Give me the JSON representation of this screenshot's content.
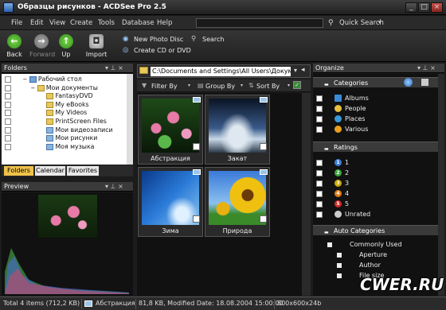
{
  "window": {
    "title": "Образцы рисунков - ACDSee Pro 2.5"
  },
  "menu": [
    "File",
    "Edit",
    "View",
    "Create",
    "Tools",
    "Database",
    "Help"
  ],
  "quick_search": {
    "label": "Quick Search"
  },
  "toolbar": {
    "back": "Back",
    "forward": "Forward",
    "up": "Up",
    "import": "Import",
    "new_photo_disc": "New Photo Disc",
    "search": "Search",
    "create_cd": "Create CD or DVD"
  },
  "folders": {
    "title": "Folders",
    "items": [
      "Рабочий стол",
      "Мои документы",
      "FantasyDVD",
      "My eBooks",
      "My Videos",
      "PrintScreen Files",
      "Мои видеозаписи",
      "Мои рисунки",
      "Моя музыка"
    ],
    "tabs": [
      "Folders",
      "Calendar",
      "Favorites"
    ]
  },
  "preview": {
    "title": "Preview"
  },
  "path": "C:\\Documents and Settings\\All Users\\Документы\\М",
  "filterbar": {
    "filter": "Filter By",
    "group": "Group By",
    "sort": "Sort By"
  },
  "thumbs": [
    {
      "label": "Абстракция"
    },
    {
      "label": "Закат"
    },
    {
      "label": "Зима"
    },
    {
      "label": "Природа"
    }
  ],
  "organize": {
    "title": "Organize",
    "categories": {
      "title": "Categories",
      "items": [
        "Albums",
        "People",
        "Places",
        "Various"
      ]
    },
    "ratings": {
      "title": "Ratings",
      "items": [
        "1",
        "2",
        "3",
        "4",
        "5"
      ],
      "unrated": "Unrated",
      "colors": [
        "#3b7fd4",
        "#3aa63a",
        "#c8a800",
        "#e07a10",
        "#d02a2a"
      ]
    },
    "auto": {
      "title": "Auto Categories",
      "items": [
        "Commonly Used",
        "Aperture",
        "Author",
        "File size"
      ]
    }
  },
  "status": {
    "total": "Total 4 items  (712,2 KB)",
    "file": "Абстракция",
    "info": "81,8 KB, Modified Date: 18.08.2004 15:00:00",
    "dims": "800x600x24b"
  },
  "watermark": "CWER.RU"
}
